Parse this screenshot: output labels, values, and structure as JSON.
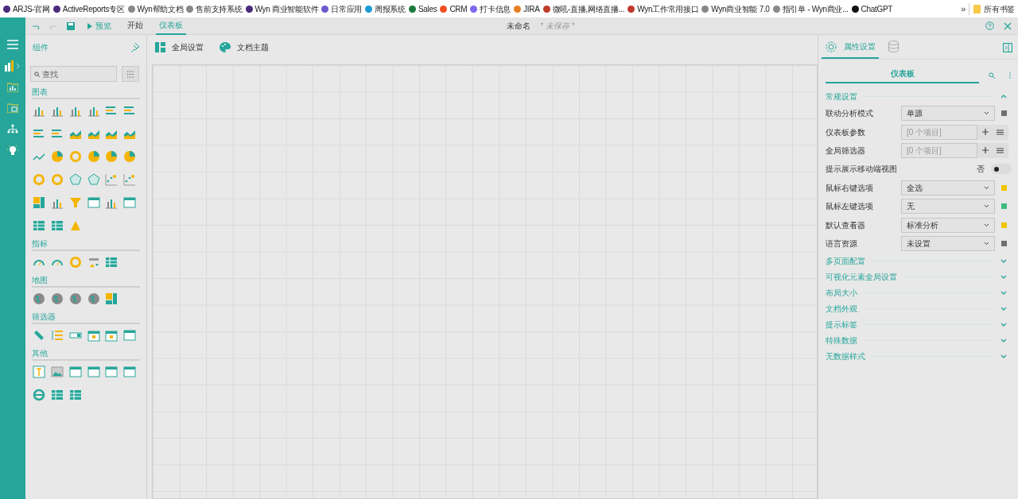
{
  "bookmarks": [
    {
      "label": "ARJS-官网",
      "color": "#4b2a7b"
    },
    {
      "label": "ActiveReports专区",
      "color": "#4b2a7b"
    },
    {
      "label": "Wyn帮助文档",
      "color": "#888888"
    },
    {
      "label": "售前支持系统",
      "color": "#888888"
    },
    {
      "label": "Wyn 商业智能软件",
      "color": "#4b2a7b"
    },
    {
      "label": "日常应用",
      "color": "#6a5acd"
    },
    {
      "label": "周报系统",
      "color": "#1e9bd7"
    },
    {
      "label": "Sales",
      "color": "#1d7a3e"
    },
    {
      "label": "CRM",
      "color": "#f25022"
    },
    {
      "label": "打卡信息",
      "color": "#7b68ee"
    },
    {
      "label": "JIRA",
      "color": "#e67e22"
    },
    {
      "label": "微吼-直播,网络直播...",
      "color": "#c0392b"
    },
    {
      "label": "Wyn工作常用接口",
      "color": "#c0392b"
    },
    {
      "label": "Wyn商业智能 7.0",
      "color": "#888888"
    },
    {
      "label": "指引单 - Wyn商业...",
      "color": "#888888"
    },
    {
      "label": "ChatGPT",
      "color": "#111111"
    }
  ],
  "bookmarks_overflow": "»",
  "all_bookmarks": "所有书签",
  "toolbar": {
    "undo_disabled": false,
    "redo_disabled": true,
    "preview": "预览",
    "tabs": [
      {
        "label": "开始",
        "selected": false
      },
      {
        "label": "仪表板",
        "selected": true
      }
    ],
    "doc_title": "未命名",
    "doc_status": "* 未保存 *"
  },
  "components": {
    "title": "组件",
    "search": {
      "placeholder": "查找"
    },
    "sections": [
      {
        "title": "图表"
      },
      {
        "title": "指标"
      },
      {
        "title": "地图"
      },
      {
        "title": "筛选器"
      },
      {
        "title": "其他"
      }
    ]
  },
  "canvas_toolbar": [
    "全局设置",
    "文档主题"
  ],
  "properties": {
    "tabs": [
      {
        "kind": "settings",
        "label": "属性设置",
        "selected": true
      },
      {
        "kind": "data",
        "selected": false
      }
    ],
    "header": "仪表板",
    "sections": [
      {
        "title": "常规设置",
        "expanded": true,
        "rows": [
          {
            "kind": "select",
            "label": "联动分析模式",
            "value": "单源",
            "color": "#707070"
          },
          {
            "kind": "list",
            "label": "仪表板参数",
            "placeholder": "[0 个项目]"
          },
          {
            "kind": "list",
            "label": "全局筛选器",
            "placeholder": "[0 个项目]"
          },
          {
            "kind": "toggle",
            "label": "提示展示移动端视图",
            "value": "否",
            "on": false
          },
          {
            "kind": "select",
            "label": "鼠标右键选项",
            "value": "全选",
            "color": "#f0c400"
          },
          {
            "kind": "select",
            "label": "鼠标左键选项",
            "value": "无",
            "color": "#3dbb7e"
          },
          {
            "kind": "select",
            "label": "默认查看器",
            "value": "标准分析",
            "color": "#f0c400"
          },
          {
            "kind": "select",
            "label": "语言资源",
            "value": "未设置",
            "color": "#707070"
          }
        ]
      },
      {
        "title": "多页面配置",
        "expanded": false
      },
      {
        "title": "可视化元素全局设置",
        "expanded": false
      },
      {
        "title": "布局大小",
        "expanded": false
      },
      {
        "title": "文档外观",
        "expanded": false
      },
      {
        "title": "提示标签",
        "expanded": false
      },
      {
        "title": "特殊数据",
        "expanded": false
      },
      {
        "title": "无数据样式",
        "expanded": false
      }
    ]
  }
}
